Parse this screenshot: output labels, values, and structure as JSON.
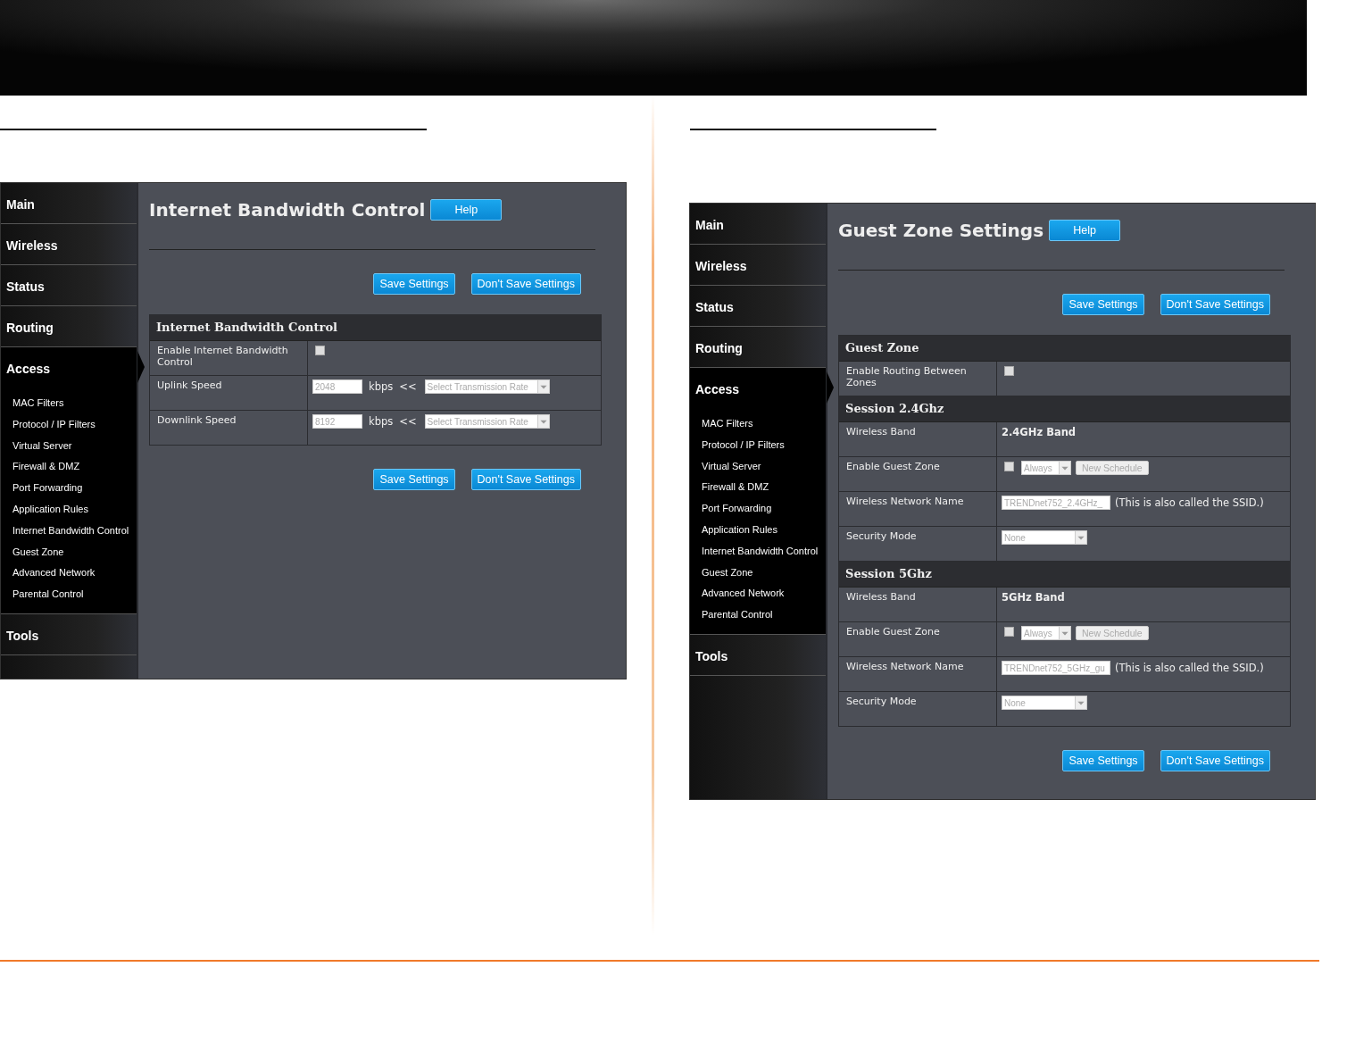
{
  "panels": [
    {
      "nav": [
        {
          "label": "Main",
          "selected": false
        },
        {
          "label": "Wireless",
          "selected": false
        },
        {
          "label": "Status",
          "selected": false
        },
        {
          "label": "Routing",
          "selected": false
        },
        {
          "label": "Access",
          "selected": true,
          "children": [
            "MAC Filters",
            "Protocol / IP Filters",
            "Virtual Server",
            "Firewall & DMZ",
            "Port Forwarding",
            "Application Rules",
            "Internet Bandwidth Control",
            "Guest Zone",
            "Advanced Network",
            "Parental Control"
          ]
        },
        {
          "label": "Tools",
          "selected": false
        }
      ],
      "title": "Internet Bandwidth Control",
      "help": "Help",
      "buttons": [
        "Save Settings",
        "Don't Save Settings"
      ],
      "groups": [
        {
          "heading": "Internet Bandwidth Control",
          "rows": [
            {
              "kind": "checkbox",
              "label": "Enable Internet Bandwidth Control",
              "checked": false
            },
            {
              "kind": "speed",
              "label": "Uplink Speed",
              "disabled": true,
              "value": "2048",
              "unit": "kbps",
              "arrow": "<<",
              "select": "Select Transmission Rate"
            },
            {
              "kind": "speed",
              "label": "Downlink Speed",
              "disabled": true,
              "value": "8192",
              "unit": "kbps",
              "arrow": "<<",
              "select": "Select Transmission Rate"
            }
          ]
        }
      ],
      "bottom_buttons": [
        "Save Settings",
        "Don't Save Settings"
      ]
    },
    {
      "nav": [
        {
          "label": "Main",
          "selected": false
        },
        {
          "label": "Wireless",
          "selected": false
        },
        {
          "label": "Status",
          "selected": false
        },
        {
          "label": "Routing",
          "selected": false
        },
        {
          "label": "Access",
          "selected": true,
          "children": [
            "MAC Filters",
            "Protocol / IP Filters",
            "Virtual Server",
            "Firewall & DMZ",
            "Port Forwarding",
            "Application Rules",
            "Internet Bandwidth Control",
            "Guest Zone",
            "Advanced Network",
            "Parental Control"
          ]
        },
        {
          "label": "Tools",
          "selected": false
        }
      ],
      "title": "Guest Zone Settings",
      "help": "Help",
      "buttons": [
        "Save Settings",
        "Don't Save Settings"
      ],
      "groups": [
        {
          "heading": "Guest Zone",
          "rows": [
            {
              "kind": "checkbox",
              "label": "Enable Routing Between Zones",
              "checked": false
            }
          ]
        },
        {
          "heading": "Session 2.4Ghz",
          "rows": [
            {
              "kind": "text",
              "label": "Wireless Band",
              "value": "2.4GHz Band"
            },
            {
              "kind": "schedule",
              "label": "Enable Guest Zone",
              "checked": false,
              "select": "Always",
              "button": "New Schedule"
            },
            {
              "kind": "ssid",
              "label": "Wireless Network Name",
              "disabled": true,
              "value": "TRENDnet752_2.4GHz_",
              "note": "(This is also called the SSID.)"
            },
            {
              "kind": "select",
              "label": "Security Mode",
              "select": "None"
            }
          ]
        },
        {
          "heading": "Session 5Ghz",
          "rows": [
            {
              "kind": "text",
              "label": "Wireless Band",
              "value": "5GHz Band"
            },
            {
              "kind": "schedule",
              "label": "Enable Guest Zone",
              "checked": false,
              "select": "Always",
              "button": "New Schedule"
            },
            {
              "kind": "ssid",
              "label": "Wireless Network Name",
              "disabled": true,
              "value": "TRENDnet752_5GHz_gu",
              "note": "(This is also called the SSID.)"
            },
            {
              "kind": "select",
              "label": "Security Mode",
              "select": "None"
            }
          ]
        }
      ],
      "bottom_buttons": [
        "Save Settings",
        "Don't Save Settings"
      ]
    }
  ]
}
